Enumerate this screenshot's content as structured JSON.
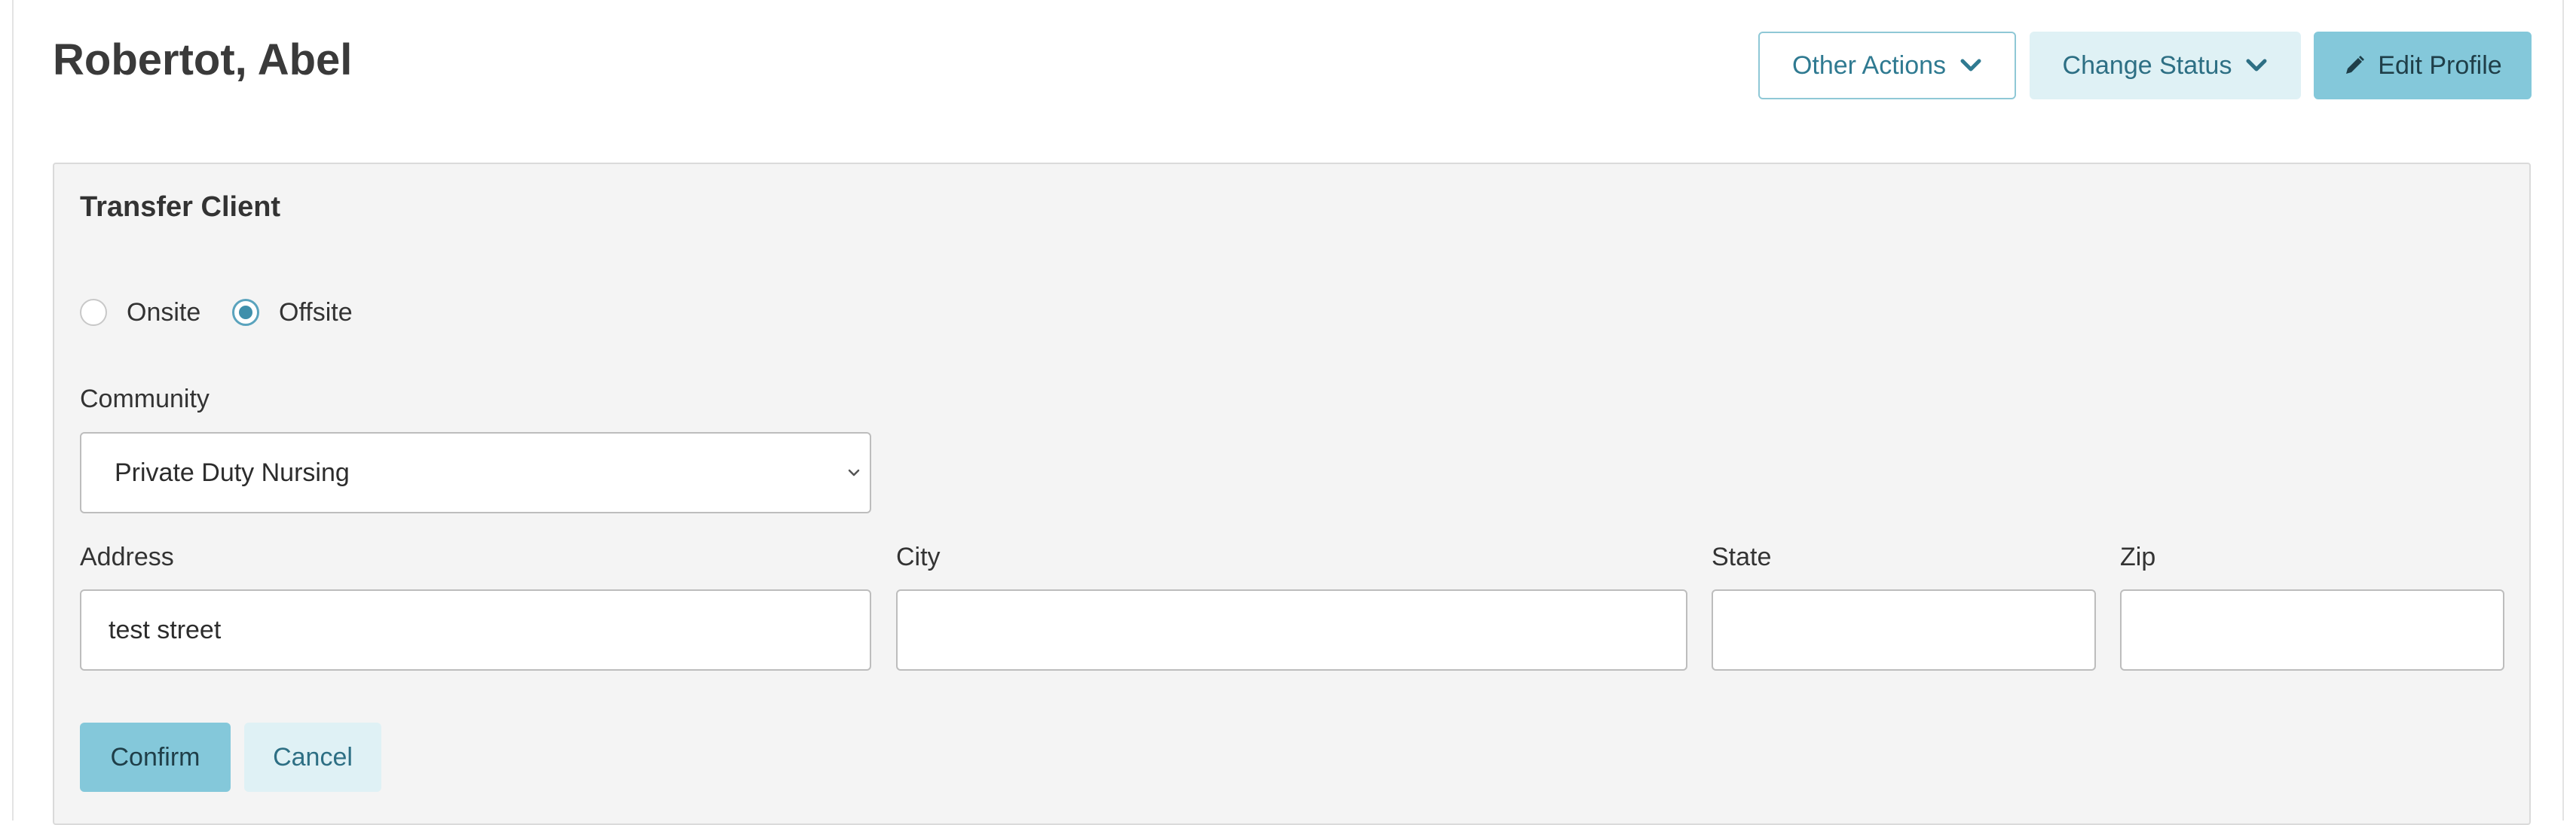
{
  "header": {
    "client_name": "Robertot, Abel",
    "other_actions_label": "Other Actions",
    "change_status_label": "Change Status",
    "edit_profile_label": "Edit Profile"
  },
  "transfer": {
    "title": "Transfer Client",
    "location_options": [
      {
        "label": "Onsite",
        "selected": false
      },
      {
        "label": "Offsite",
        "selected": true
      }
    ],
    "community": {
      "label": "Community",
      "value": "Private Duty Nursing"
    },
    "address": {
      "label": "Address",
      "value": "test street"
    },
    "city": {
      "label": "City",
      "value": ""
    },
    "state": {
      "label": "State",
      "value": ""
    },
    "zip": {
      "label": "Zip",
      "value": ""
    },
    "confirm_label": "Confirm",
    "cancel_label": "Cancel"
  },
  "colors": {
    "accent": "#84c8da",
    "accent_light": "#dff1f5",
    "accent_text": "#2f7a91",
    "radio_checked": "#3f8fab",
    "panel_bg": "#f4f4f4"
  },
  "icons": [
    "chevron-down-icon",
    "pencil-icon",
    "select-caret-icon"
  ]
}
